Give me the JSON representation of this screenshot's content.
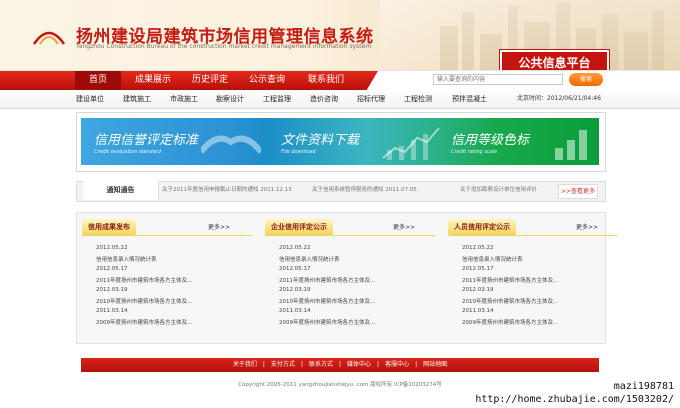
{
  "header": {
    "title_cn": "扬州建设局建筑市场信用管理信息系统",
    "title_en": "Yangzhou Construction Bureau of the construction market credit management information system",
    "platform": "公共信息平台"
  },
  "nav": {
    "items": [
      "首页",
      "成果展示",
      "历史评定",
      "公示查询",
      "联系我们"
    ],
    "active_index": 0
  },
  "search": {
    "placeholder": "输入要查询的内容",
    "button_label": "搜索"
  },
  "subnav": {
    "items": [
      "建设单位",
      "建筑施工",
      "市政施工",
      "勘察设计",
      "工程监理",
      "造价咨询",
      "招标代理",
      "工程检测",
      "预拌混凝土"
    ],
    "datetime": "北京时间：2012/06/21/04:46"
  },
  "banner": {
    "items": [
      {
        "title": "信用信誉评定标准",
        "subtitle": "Credit evaluation standard"
      },
      {
        "title": "文件资料下载",
        "subtitle": "File download"
      },
      {
        "title": "信用等级色标",
        "subtitle": "Credit rating scale"
      }
    ]
  },
  "notice": {
    "label": "通知通告",
    "items": [
      "关于2011年度信用申报截止日期的通知  2011.12.13",
      "关于信用系统暂停服务的通知  2011.07.05",
      "关于增加勘察设计单位信用评价"
    ],
    "more": ">>查看更多"
  },
  "panels": [
    {
      "title": "信用成果发布",
      "more": "更多>>",
      "rows": [
        "2012.05.22",
        "信用信息录入情况统计表",
        "2012.05.17",
        "2011年度扬州市建筑市场各方主体及...",
        "2012.03.19",
        "2010年度扬州市建筑市场各方主体及...",
        "2011.03.14",
        "2009年度扬州市建筑市场各方主体及..."
      ]
    },
    {
      "title": "企业信用评定公示",
      "more": "更多>>",
      "rows": [
        "2012.05.22",
        "信用信息录入情况统计表",
        "2012.05.17",
        "2011年度扬州市建筑市场各方主体及...",
        "2012.03.19",
        "2010年度扬州市建筑市场各方主体及...",
        "2011.03.14",
        "2009年度扬州市建筑市场各方主体及..."
      ]
    },
    {
      "title": "人员信用评定公示",
      "more": "更多>>",
      "rows": [
        "2012.05.22",
        "信用信息录入情况统计表",
        "2012.05.17",
        "2011年度扬州市建筑市场各方主体及...",
        "2012.03.19",
        "2010年度扬州市建筑市场各方主体及...",
        "2011.03.14",
        "2009年度扬州市建筑市场各方主体及..."
      ]
    }
  ],
  "footer": {
    "links": [
      "关于我们",
      "支付方式",
      "联系方式",
      "媒体中心",
      "客服中心",
      "网站地图"
    ],
    "separator": "|",
    "copyright": "Copyright 2005-2011 yangzhoujianshejyu .com 版权所有 ICP备10203274号"
  },
  "watermark": {
    "user": "mazi198781",
    "url": "http://home.zhubajie.com/1503202/"
  },
  "colors": {
    "brand_red": "#c5140e",
    "nav_red": "#e42a1c",
    "banner_blue": "#2d92d4",
    "banner_green": "#0b9d3a",
    "panel_gold": "#f2d35c"
  }
}
